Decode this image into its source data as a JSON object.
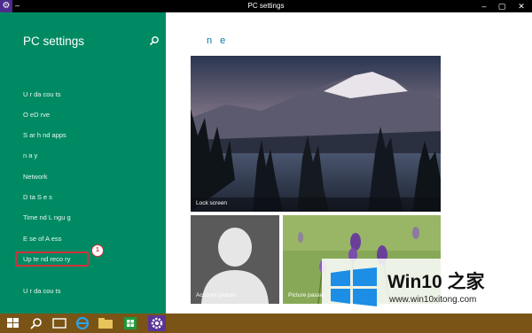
{
  "window": {
    "icon_glyph": "⚙",
    "menu_label": "–",
    "title": "PC settings",
    "minimize_label": "–",
    "maximize_label": "▢",
    "close_label": "✕"
  },
  "sidebar": {
    "title": "PC settings",
    "search_icon": "search-icon",
    "items": [
      {
        "label": "U   r     da  cou  ts"
      },
      {
        "label": "O   eD  rve"
      },
      {
        "label": "S  ar  h    nd apps"
      },
      {
        "label": "   n  a  y"
      },
      {
        "label": "Network"
      },
      {
        "label": "D  ta  S e  s"
      },
      {
        "label": "Time   nd L  ngu  g"
      },
      {
        "label": "E  se of A    ess"
      },
      {
        "label": "Up     te    nd reco     ry"
      },
      {
        "label": "U   r     da  cou  ts"
      }
    ],
    "badge": "1"
  },
  "main": {
    "heading": "n   e",
    "tiles": {
      "lock": "Lock screen",
      "account": "Account picture",
      "password": "Picture passw"
    }
  },
  "watermark": {
    "brand": "Win10 之家",
    "url": "www.win10xitong.com"
  },
  "taskbar": {
    "icons": [
      "windows-start-icon",
      "search-icon",
      "task-view-icon",
      "internet-explorer-icon",
      "file-explorer-icon",
      "store-icon",
      "settings-icon"
    ]
  },
  "colors": {
    "sidebar": "#008a63",
    "taskbar": "#7a5416",
    "highlight": "#d6303a",
    "heading": "#0078a8"
  }
}
